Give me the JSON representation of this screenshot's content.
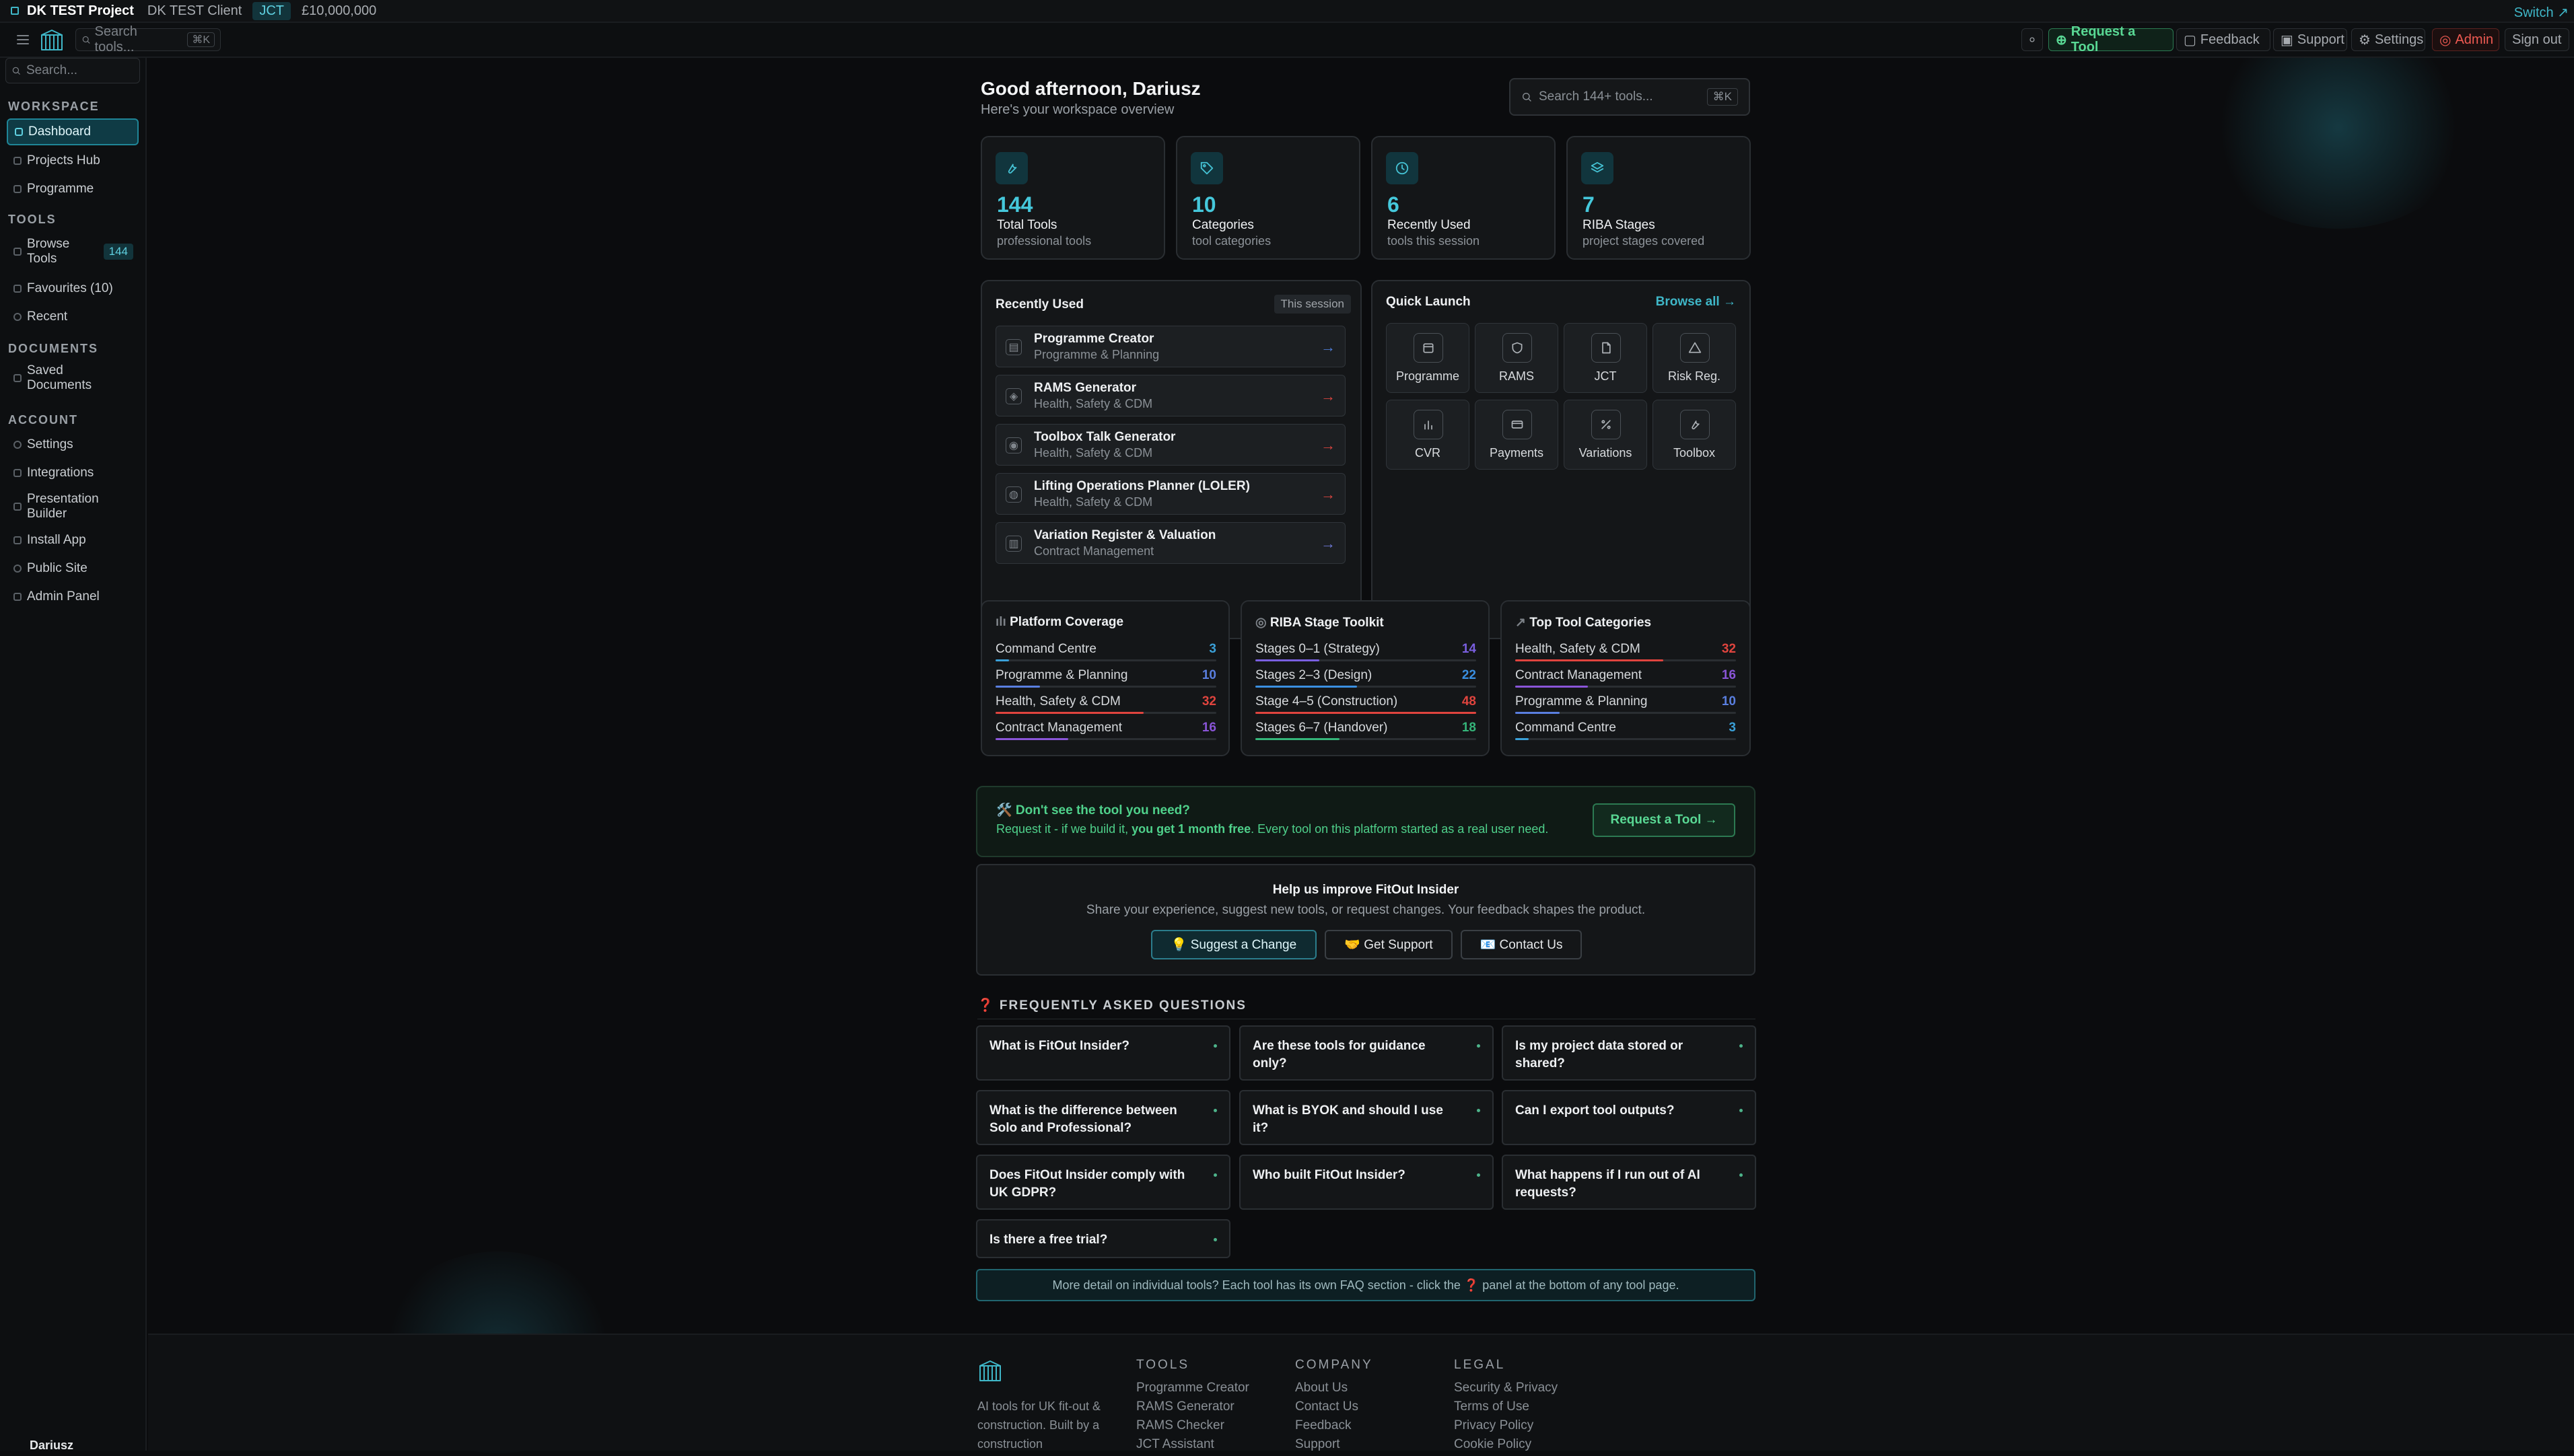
{
  "project_bar": {
    "project": "DK TEST Project",
    "client": "DK TEST Client",
    "contract": "JCT",
    "value": "£10,000,000",
    "switch": "Switch ↗"
  },
  "top_nav": {
    "search_placeholder": "Search tools...",
    "search_shortcut": "⌘K",
    "request_tool": "Request a Tool",
    "feedback": "Feedback",
    "support": "Support",
    "settings": "Settings",
    "admin": "Admin",
    "sign_out": "Sign out"
  },
  "sidebar": {
    "search_placeholder": "Search...",
    "sections": {
      "workspace": "WORKSPACE",
      "tools": "TOOLS",
      "documents": "DOCUMENTS",
      "account": "ACCOUNT"
    },
    "workspace_items": [
      "Dashboard",
      "Projects Hub",
      "Programme"
    ],
    "browse_tools": "Browse Tools",
    "browse_tools_count": "144",
    "favourites": "Favourites (10)",
    "recent": "Recent",
    "saved_documents": "Saved Documents",
    "account_items": [
      "Settings",
      "Integrations",
      "Presentation Builder",
      "Install App",
      "Public Site",
      "Admin Panel"
    ],
    "user_name": "Dariusz"
  },
  "header": {
    "greeting": "Good afternoon, Dariusz",
    "subtitle": "Here's your workspace overview",
    "search_placeholder": "Search 144+ tools...",
    "search_shortcut": "⌘K"
  },
  "stats": [
    {
      "value": "144",
      "label": "Total Tools",
      "sub": "professional tools",
      "icon": "wrench-icon"
    },
    {
      "value": "10",
      "label": "Categories",
      "sub": "tool categories",
      "icon": "tag-icon"
    },
    {
      "value": "6",
      "label": "Recently Used",
      "sub": "tools this session",
      "icon": "clock-icon"
    },
    {
      "value": "7",
      "label": "RIBA Stages",
      "sub": "project stages covered",
      "icon": "layers-icon"
    }
  ],
  "recently_used": {
    "title": "Recently Used",
    "badge": "This session",
    "items": [
      {
        "title": "Programme Creator",
        "category": "Programme & Planning",
        "arrow_color": "#4f7dd8"
      },
      {
        "title": "RAMS Generator",
        "category": "Health, Safety & CDM",
        "arrow_color": "#d9453f"
      },
      {
        "title": "Toolbox Talk Generator",
        "category": "Health, Safety & CDM",
        "arrow_color": "#d9453f"
      },
      {
        "title": "Lifting Operations Planner (LOLER)",
        "category": "Health, Safety & CDM",
        "arrow_color": "#d9453f"
      },
      {
        "title": "Variation Register & Valuation",
        "category": "Contract Management",
        "arrow_color": "#6f7ad8"
      }
    ]
  },
  "quick_launch": {
    "title": "Quick Launch",
    "browse_all": "Browse all →",
    "tiles": [
      {
        "label": "Programme",
        "icon": "calendar-icon"
      },
      {
        "label": "RAMS",
        "icon": "shield-icon"
      },
      {
        "label": "JCT",
        "icon": "document-icon"
      },
      {
        "label": "Risk Reg.",
        "icon": "warning-icon"
      },
      {
        "label": "CVR",
        "icon": "bar-chart-icon"
      },
      {
        "label": "Payments",
        "icon": "card-icon"
      },
      {
        "label": "Variations",
        "icon": "sliders-icon"
      },
      {
        "label": "Toolbox",
        "icon": "wrench-icon"
      }
    ]
  },
  "platform_coverage": {
    "title": "Platform Coverage",
    "rows": [
      {
        "name": "Command Centre",
        "value": "3",
        "color": "#3aa0d8",
        "fraction": 0.06
      },
      {
        "name": "Programme & Planning",
        "value": "10",
        "color": "#5a7fe0",
        "fraction": 0.2
      },
      {
        "name": "Health, Safety & CDM",
        "value": "32",
        "color": "#e0443e",
        "fraction": 0.67
      },
      {
        "name": "Contract Management",
        "value": "16",
        "color": "#8a55d8",
        "fraction": 0.33
      }
    ]
  },
  "riba_toolkit": {
    "title": "RIBA Stage Toolkit",
    "rows": [
      {
        "name": "Stages 0–1 (Strategy)",
        "value": "14",
        "color": "#7a5fe0",
        "fraction": 0.29
      },
      {
        "name": "Stages 2–3 (Design)",
        "value": "22",
        "color": "#3a8fe0",
        "fraction": 0.46
      },
      {
        "name": "Stage 4–5 (Construction)",
        "value": "48",
        "color": "#e0443e",
        "fraction": 1.0
      },
      {
        "name": "Stages 6–7 (Handover)",
        "value": "18",
        "color": "#35b57a",
        "fraction": 0.38
      }
    ]
  },
  "top_categories": {
    "title": "Top Tool Categories",
    "rows": [
      {
        "name": "Health, Safety & CDM",
        "value": "32",
        "color": "#e0443e",
        "fraction": 0.67
      },
      {
        "name": "Contract Management",
        "value": "16",
        "color": "#8a55d8",
        "fraction": 0.33
      },
      {
        "name": "Programme & Planning",
        "value": "10",
        "color": "#5a7fe0",
        "fraction": 0.2
      },
      {
        "name": "Command Centre",
        "value": "3",
        "color": "#3aa0d8",
        "fraction": 0.06
      }
    ]
  },
  "request_banner": {
    "title": "🛠️ Don't see the tool you need?",
    "text_before": "Request it - if we build it, ",
    "text_bold": "you get 1 month free",
    "text_after": ". Every tool on this platform started as a real user need.",
    "button": "Request a Tool →"
  },
  "improve": {
    "title": "Help us improve FitOut Insider",
    "subtitle": "Share your experience, suggest new tools, or request changes. Your feedback shapes the product.",
    "suggest": "💡 Suggest a Change",
    "support": "🤝 Get Support",
    "contact": "📧 Contact Us"
  },
  "faq": {
    "title": "❓ FREQUENTLY ASKED QUESTIONS",
    "questions": [
      "What is FitOut Insider?",
      "Are these tools for guidance only?",
      "Is my project data stored or shared?",
      "What is the difference between Solo and Professional?",
      "What is BYOK and should I use it?",
      "Can I export tool outputs?",
      "Does FitOut Insider comply with UK GDPR?",
      "Who built FitOut Insider?",
      "What happens if I run out of AI requests?",
      "Is there a free trial?"
    ],
    "more_detail": "More detail on individual tools?  Each tool has its own FAQ section - click the ❓ panel at the bottom of any tool page."
  },
  "footer": {
    "tagline": "AI tools for UK fit-out & construction. Built by a construction",
    "tools_heading": "TOOLS",
    "tools": [
      "Programme Creator",
      "RAMS Generator",
      "RAMS Checker",
      "JCT Assistant"
    ],
    "company_heading": "COMPANY",
    "company": [
      "About Us",
      "Contact Us",
      "Feedback",
      "Support"
    ],
    "legal_heading": "LEGAL",
    "legal": [
      "Security & Privacy",
      "Terms of Use",
      "Privacy Policy",
      "Cookie Policy"
    ]
  },
  "colors": {
    "accent": "#3fb7c8",
    "background": "#0b0c0e",
    "card": "#141618",
    "admin_red": "#e0443e",
    "request_green": "#4fd18b"
  }
}
